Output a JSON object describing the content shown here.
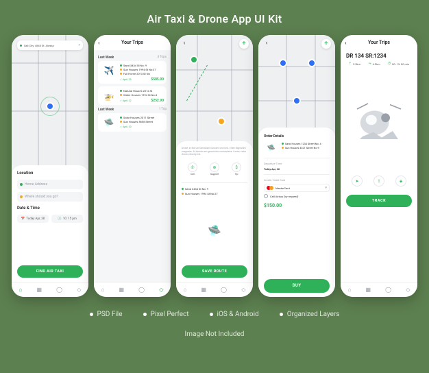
{
  "page": {
    "title": "Air Taxi & Drone App UI Kit",
    "note": "Image Not Included"
  },
  "features": [
    "PSD File",
    "Pixel Perfect",
    "iOS & Android",
    "Organized Layers"
  ],
  "screen1": {
    "address": "Sall City, 4848 St. Alaska",
    "location_label": "Location",
    "pickup_placeholder": "Home Address",
    "dropoff_placeholder": "Where should you go?",
    "datetime_label": "Date & Time",
    "date": "Today Apr, 30",
    "time": "10. 15 pm",
    "cta": "FIND AIR TAXI"
  },
  "screen2": {
    "header": "Your Trips",
    "week1_label": "Last Week",
    "week1_count": "4 Trips",
    "week2_label": "Last Week",
    "week2_count": "1 Trip",
    "trips": [
      {
        "from": "Sand 3434 St No: 9",
        "to": "Sun Houses 1994 St No:37",
        "extra": "Full Home 2013 St No",
        "date": "April, 23",
        "price": "$585.90"
      },
      {
        "from": "Natural Houses 2012 St",
        "to": "Water Houses 1994 St No:4",
        "date": "April, 22",
        "price": "$252.90"
      },
      {
        "from": "Solar Houses 2011 Street",
        "to": "Sun Houses 5658 Street",
        "date": "April, 20",
        "price": ""
      }
    ]
  },
  "screen3": {
    "desc": "Drone, in fact an tamodam nuncam ond lost. Eliter dignissim magnaue. At lacinia non gummodo consectetur. Lorem vatur drone velocity est.",
    "actions": {
      "call": "Call",
      "support": "Support",
      "tip": "Tip"
    },
    "from": "Sand 3434 St No: 9",
    "to": "Sun Houses 1994 St No:27",
    "cta": "SAVE ROUTE"
  },
  "screen4": {
    "order_label": "Order Details",
    "from": "Sand Houses 1234 Street No: 4",
    "to": "Sun Houses 4321 Street No:9",
    "departure_label": "Departure Time",
    "departure": "Today Apr, 30",
    "pay_label": "Credit / Debit Card",
    "card": "MasterCard",
    "alt_pay": "Call Airbus (by request)",
    "total": "$150.00",
    "cta": "BUY"
  },
  "screen5": {
    "header": "Your Trips",
    "code": "DR 134 SR:1234",
    "metrics": {
      "alt": "2.5km",
      "dist": "4.5km",
      "time": "00: 13: 00 min"
    },
    "cta": "TRACK"
  }
}
